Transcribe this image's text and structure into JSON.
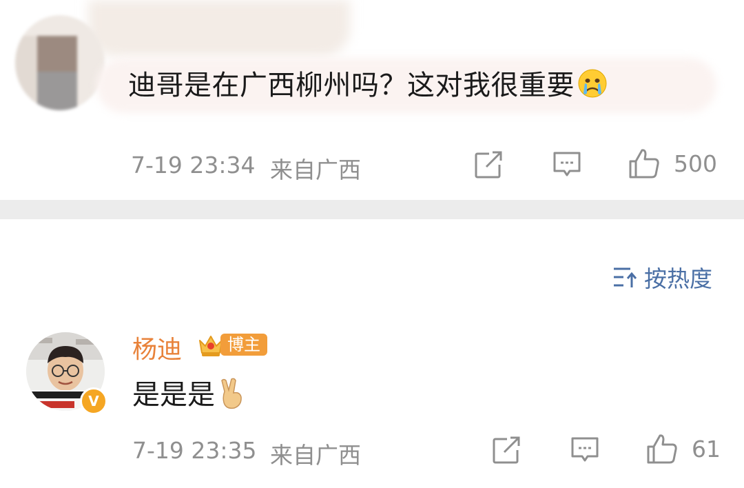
{
  "post": {
    "text": "迪哥是在广西柳州吗？这对我很重要",
    "emoji": "crying-face",
    "time": "7-19 23:34",
    "source": "来自广西",
    "likes": "500"
  },
  "sort": {
    "label": "按热度"
  },
  "reply": {
    "author": "杨迪",
    "badge": "博主",
    "verified_mark": "V",
    "text": "是是是",
    "emoji": "victory-hand",
    "time": "7-19 23:35",
    "source": "来自广西",
    "likes": "61"
  },
  "colors": {
    "accent_blue": "#4a6fa5",
    "name_orange": "#e8823a",
    "badge_orange": "#f29d3a",
    "meta_gray": "#8f8f8f",
    "divider": "#ececec"
  }
}
